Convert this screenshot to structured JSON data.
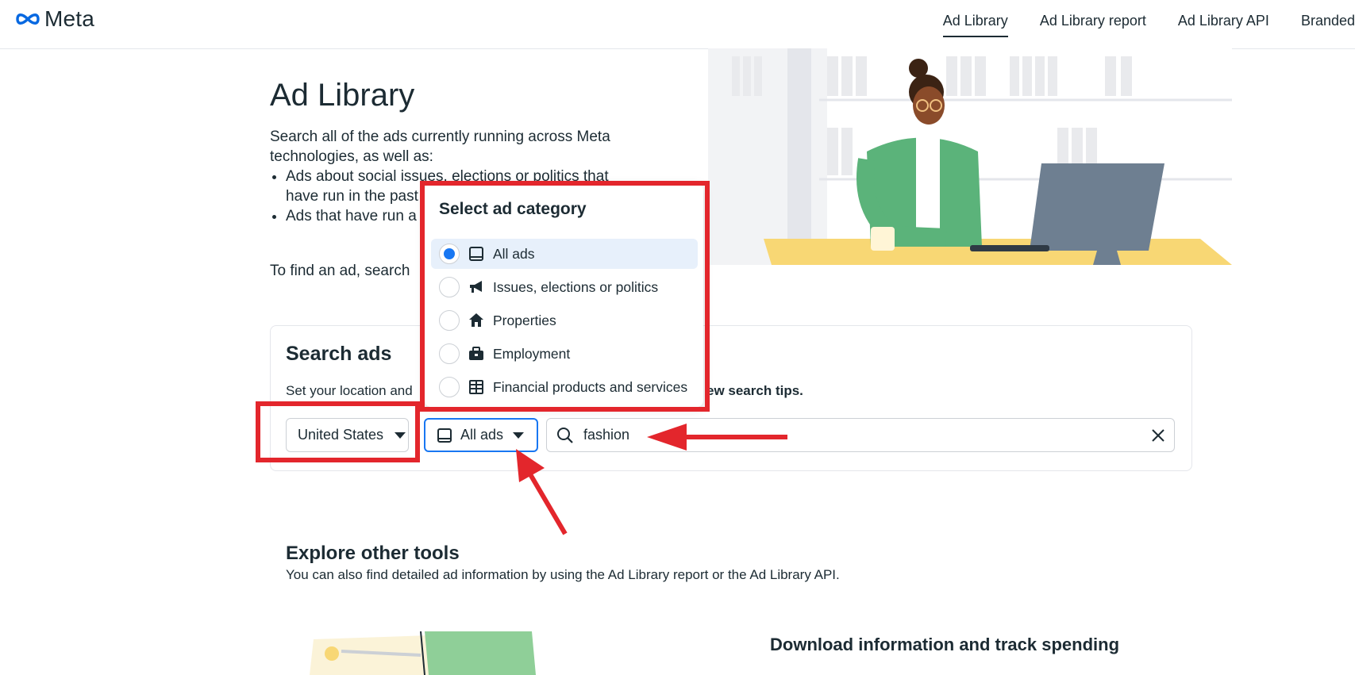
{
  "brand": {
    "name": "Meta"
  },
  "nav": {
    "items": [
      {
        "label": "Ad Library",
        "active": true
      },
      {
        "label": "Ad Library report",
        "active": false
      },
      {
        "label": "Ad Library API",
        "active": false
      },
      {
        "label": "Branded",
        "active": false
      }
    ]
  },
  "hero": {
    "title": "Ad Library",
    "intro": "Search all of the ads currently running across Meta technologies, as well as:",
    "bullets": [
      "Ads about social issues, elections or politics that have run in the past",
      "Ads that have run a year"
    ],
    "find_text": "To find an ad, search"
  },
  "search": {
    "title": "Search ads",
    "description": "Set your location and",
    "tips_tail": "ew search tips.",
    "country": "United States",
    "category": "All ads",
    "query": "fashion"
  },
  "dropdown": {
    "title": "Select ad category",
    "options": [
      {
        "label": "All ads",
        "icon": "tablet-icon",
        "selected": true
      },
      {
        "label": "Issues, elections or politics",
        "icon": "megaphone-icon",
        "selected": false
      },
      {
        "label": "Properties",
        "icon": "house-icon",
        "selected": false
      },
      {
        "label": "Employment",
        "icon": "briefcase-icon",
        "selected": false
      },
      {
        "label": "Financial products and services",
        "icon": "bank-icon",
        "selected": false
      }
    ]
  },
  "explore": {
    "title": "Explore other tools",
    "description": "You can also find detailed ad information by using the Ad Library report or the Ad Library API.",
    "download_title": "Download information and track spending"
  },
  "colors": {
    "accent": "#1877f2",
    "annotation": "#e3262c",
    "text": "#1c2b33"
  }
}
